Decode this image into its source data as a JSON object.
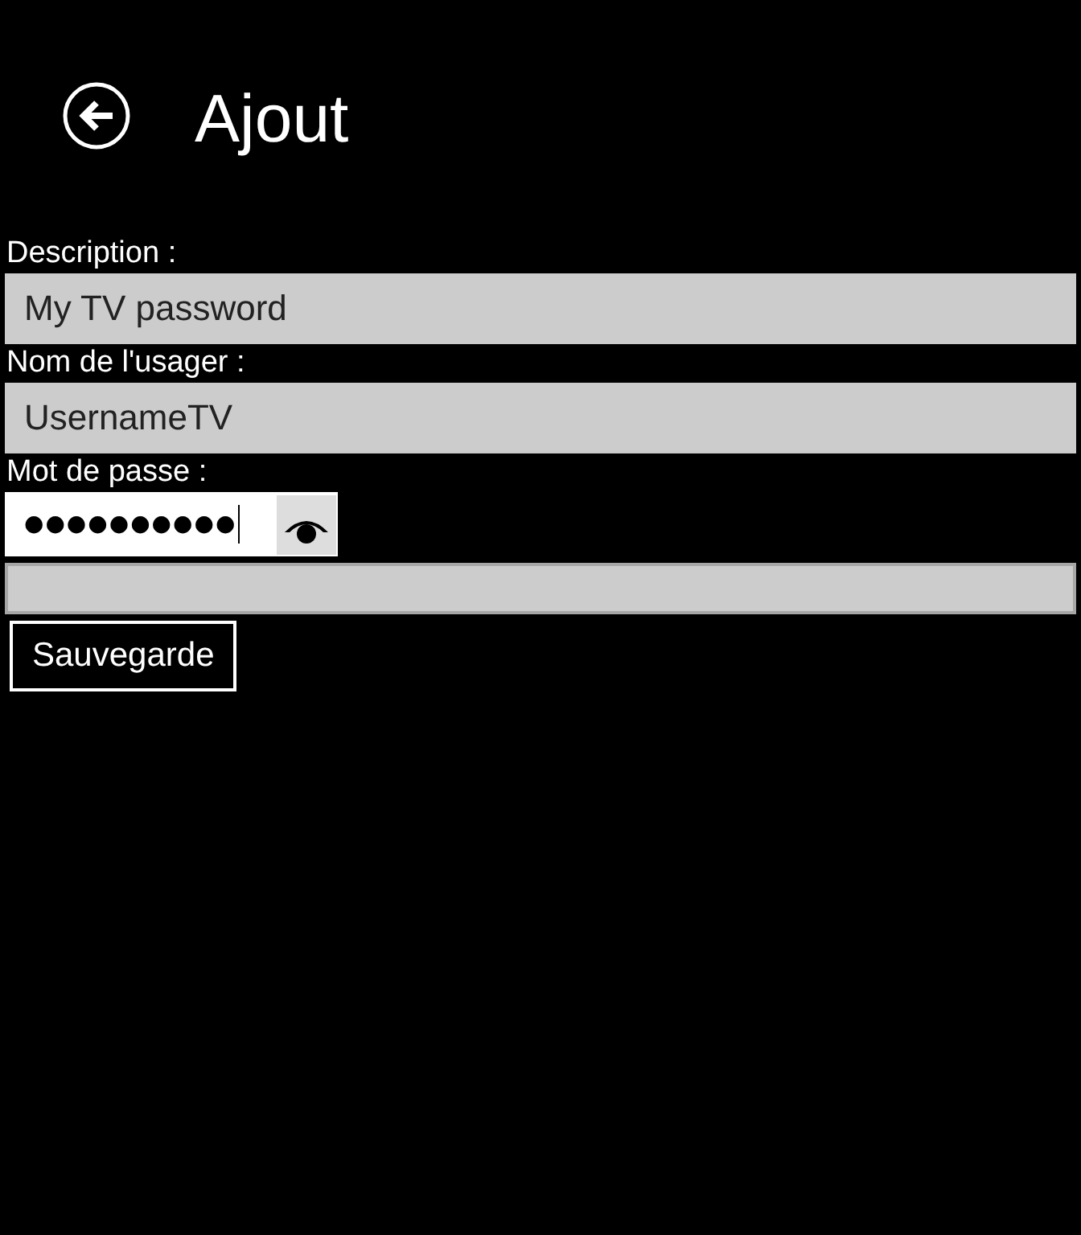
{
  "header": {
    "title": "Ajout"
  },
  "fields": [
    {
      "kind": "text",
      "label": "Description :",
      "value": "My TV password"
    },
    {
      "kind": "text",
      "label": "Nom de l'usager :",
      "value": "UsernameTV"
    },
    {
      "kind": "password",
      "label": "Mot de passe :",
      "value": "●●●●●●●●●●"
    },
    {
      "kind": "blank"
    }
  ],
  "buttons": [
    {
      "label": "Sauvegarde"
    }
  ]
}
